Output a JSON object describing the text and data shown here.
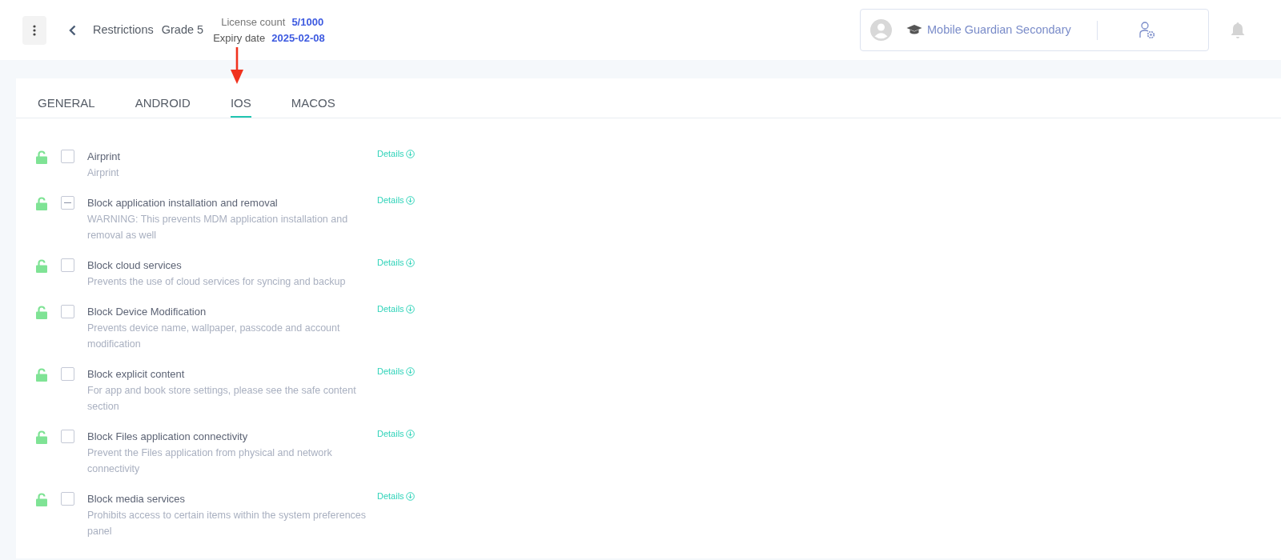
{
  "header": {
    "breadcrumb": [
      "Restrictions",
      "Grade 5"
    ],
    "license_label": "License count",
    "license_value": "5/1000",
    "expiry_label": "Expiry date",
    "expiry_value": "2025-02-08",
    "school": "Mobile Guardian Secondary"
  },
  "tabs": [
    {
      "label": "GENERAL",
      "selected": false
    },
    {
      "label": "ANDROID",
      "selected": false
    },
    {
      "label": "IOS",
      "selected": true
    },
    {
      "label": "MACOS",
      "selected": false
    }
  ],
  "restrictions": [
    {
      "title": "Airprint",
      "description": "Airprint",
      "locked": false,
      "indeterminate": false,
      "details": "Details"
    },
    {
      "title": "Block application installation and removal",
      "description": "WARNING: This prevents MDM application installation and removal as well",
      "locked": false,
      "indeterminate": true,
      "details": "Details"
    },
    {
      "title": "Block cloud services",
      "description": "Prevents the use of cloud services for syncing and backup",
      "locked": false,
      "indeterminate": false,
      "details": "Details"
    },
    {
      "title": "Block Device Modification",
      "description": "Prevents device name, wallpaper, passcode and account modification",
      "locked": false,
      "indeterminate": false,
      "details": "Details"
    },
    {
      "title": "Block explicit content",
      "description": "For app and book store settings, please see the safe content section",
      "locked": false,
      "indeterminate": false,
      "details": "Details"
    },
    {
      "title": "Block Files application connectivity",
      "description": "Prevent the Files application from physical and network connectivity",
      "locked": false,
      "indeterminate": false,
      "details": "Details"
    },
    {
      "title": "Block media services",
      "description": "Prohibits access to certain items within the system preferences panel",
      "locked": false,
      "indeterminate": false,
      "details": "Details"
    }
  ]
}
